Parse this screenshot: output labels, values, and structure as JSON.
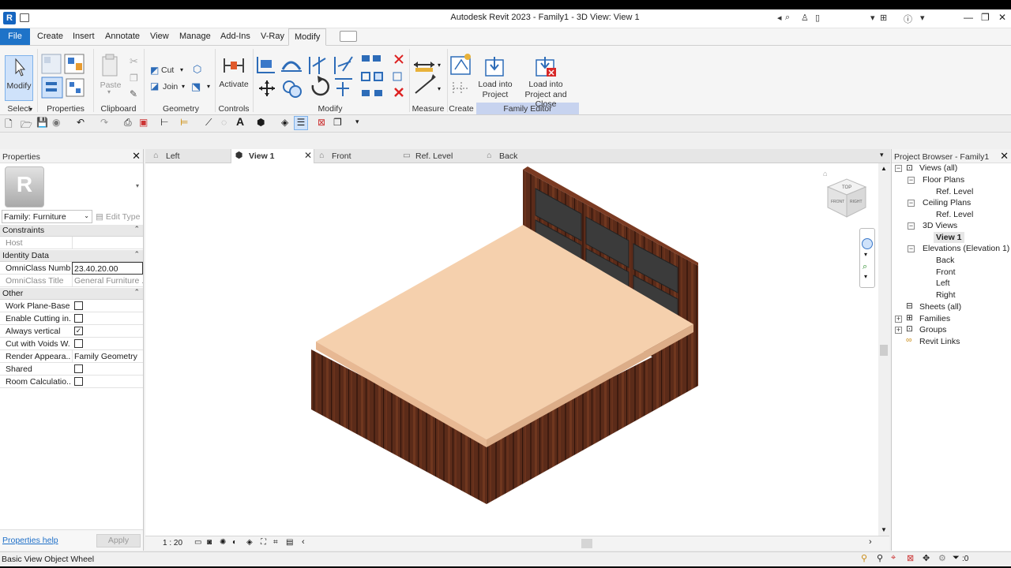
{
  "titlebar": {
    "title": "Autodesk Revit 2023 - Family1 - 3D View: View 1",
    "app_logo": "R"
  },
  "ribbon": {
    "tabs": [
      "File",
      "Create",
      "Insert",
      "Annotate",
      "View",
      "Manage",
      "Add-Ins",
      "V-Ray",
      "Modify"
    ],
    "active_tab": "Modify",
    "buttons": {
      "modify": "Modify",
      "paste": "Paste",
      "cut": "Cut",
      "join": "Join",
      "activate": "Activate",
      "load_into_project_1": "Load into",
      "load_into_project_2": "Project",
      "load_close_1": "Load into",
      "load_close_2": "Project and Close"
    },
    "panel_labels": {
      "select": "Select",
      "properties": "Properties",
      "clipboard": "Clipboard",
      "geometry": "Geometry",
      "controls": "Controls",
      "modify": "Modify",
      "measure": "Measure",
      "create": "Create",
      "family_editor": "Family Editor"
    }
  },
  "properties": {
    "title": "Properties",
    "type_logo": "R",
    "family_selector": "Family: Furniture",
    "edit_type": "Edit Type",
    "sections": {
      "constraints": "Constraints",
      "identity": "Identity Data",
      "other": "Other"
    },
    "constraints_rows": [
      {
        "label": "Host",
        "value": ""
      }
    ],
    "identity_rows": [
      {
        "label": "OmniClass Numb...",
        "value": "23.40.20.00"
      },
      {
        "label": "OmniClass Title",
        "value": "General Furniture ..."
      }
    ],
    "other_rows": [
      {
        "label": "Work Plane-Based",
        "checked": ""
      },
      {
        "label": "Enable Cutting in...",
        "checked": ""
      },
      {
        "label": "Always vertical",
        "checked": "✓"
      },
      {
        "label": "Cut with Voids W...",
        "checked": ""
      },
      {
        "label": "Render Appeara...",
        "value": "Family Geometry"
      },
      {
        "label": "Shared",
        "checked": ""
      },
      {
        "label": "Room Calculatio...",
        "checked": ""
      }
    ],
    "help_link": "Properties help",
    "apply": "Apply"
  },
  "view_tabs": [
    {
      "label": "Left"
    },
    {
      "label": "View 1"
    },
    {
      "label": "Front"
    },
    {
      "label": "Ref. Level"
    },
    {
      "label": "Back"
    }
  ],
  "viewcube": {
    "top": "TOP",
    "front": "FRONT",
    "right": "RIGHT"
  },
  "view_control": {
    "scale": "1 : 20"
  },
  "browser": {
    "title": "Project Browser - Family1",
    "nodes": [
      {
        "label": "Views (all)",
        "box": "−"
      },
      {
        "label": "Floor Plans",
        "box": "−"
      },
      {
        "label": "Ref. Level"
      },
      {
        "label": "Ceiling Plans",
        "box": "−"
      },
      {
        "label": "Ref. Level"
      },
      {
        "label": "3D Views",
        "box": "−"
      },
      {
        "label": "View 1"
      },
      {
        "label": "Elevations (Elevation 1)",
        "box": "−"
      },
      {
        "label": "Back"
      },
      {
        "label": "Front"
      },
      {
        "label": "Left"
      },
      {
        "label": "Right"
      },
      {
        "label": "Sheets (all)",
        "box": ""
      },
      {
        "label": "Families",
        "box": "+"
      },
      {
        "label": "Groups",
        "box": "+"
      },
      {
        "label": "Revit Links"
      }
    ]
  },
  "status": {
    "text": "Basic View Object Wheel",
    "filter_count": ":0"
  },
  "colors": {
    "file_tab": "#1e73c8",
    "mattress": "#f5d0ad",
    "wood": "#5a2a18",
    "headboard_panel": "#3a3a3a"
  }
}
